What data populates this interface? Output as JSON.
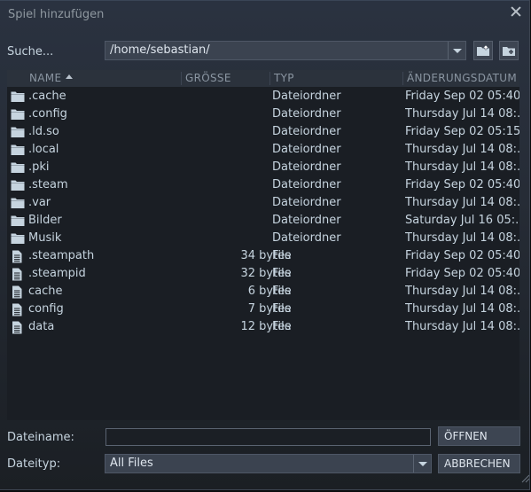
{
  "window": {
    "title": "Spiel hinzufügen"
  },
  "search": {
    "label": "Suche...",
    "path": "/home/sebastian/"
  },
  "columns": {
    "name": "NAME",
    "size": "GRÖSSE",
    "type": "TYP",
    "modified": "ÄNDERUNGSDATUM"
  },
  "files": [
    {
      "name": ".cache",
      "size": "",
      "type": "Dateiordner",
      "modified": "Friday Sep 02 05:40...",
      "icon": "folder-icon"
    },
    {
      "name": ".config",
      "size": "",
      "type": "Dateiordner",
      "modified": "Thursday Jul 14 08:...",
      "icon": "folder-icon"
    },
    {
      "name": ".ld.so",
      "size": "",
      "type": "Dateiordner",
      "modified": "Friday Sep 02 05:15...",
      "icon": "folder-icon"
    },
    {
      "name": ".local",
      "size": "",
      "type": "Dateiordner",
      "modified": "Thursday Jul 14 08:...",
      "icon": "folder-icon"
    },
    {
      "name": ".pki",
      "size": "",
      "type": "Dateiordner",
      "modified": "Thursday Jul 14 08:...",
      "icon": "folder-icon"
    },
    {
      "name": ".steam",
      "size": "",
      "type": "Dateiordner",
      "modified": "Friday Sep 02 05:40...",
      "icon": "folder-icon"
    },
    {
      "name": ".var",
      "size": "",
      "type": "Dateiordner",
      "modified": "Thursday Jul 14 08:...",
      "icon": "folder-icon"
    },
    {
      "name": "Bilder",
      "size": "",
      "type": "Dateiordner",
      "modified": "Saturday Jul 16 05:...",
      "icon": "folder-icon"
    },
    {
      "name": "Musik",
      "size": "",
      "type": "Dateiordner",
      "modified": "Thursday Jul 14 08:...",
      "icon": "folder-icon"
    },
    {
      "name": ".steampath",
      "size": "34 bytes",
      "type": "File",
      "modified": "Friday Sep 02 05:40...",
      "icon": "file-icon"
    },
    {
      "name": ".steampid",
      "size": "32 bytes",
      "type": "File",
      "modified": "Friday Sep 02 05:40...",
      "icon": "file-icon"
    },
    {
      "name": "cache",
      "size": "6 bytes",
      "type": "File",
      "modified": "Thursday Jul 14 08:...",
      "icon": "file-icon"
    },
    {
      "name": "config",
      "size": "7 bytes",
      "type": "File",
      "modified": "Thursday Jul 14 08:...",
      "icon": "file-icon"
    },
    {
      "name": "data",
      "size": "12 bytes",
      "type": "File",
      "modified": "Thursday Jul 14 08:...",
      "icon": "file-icon"
    }
  ],
  "filename": {
    "label": "Dateiname:",
    "value": ""
  },
  "filetype": {
    "label": "Dateityp:",
    "value": "All Files"
  },
  "buttons": {
    "open": "ÖFFNEN",
    "cancel": "ABBRECHEN"
  }
}
